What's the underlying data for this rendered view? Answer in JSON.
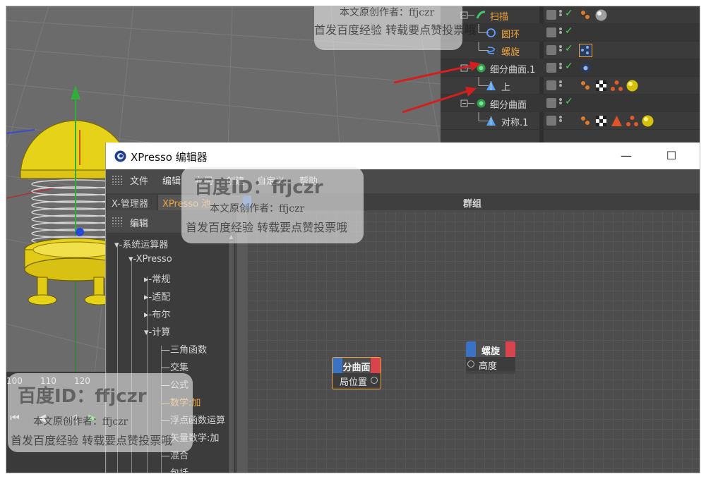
{
  "object_manager": {
    "rows": [
      {
        "name": "扫描",
        "color": "orange"
      },
      {
        "name": "圆环",
        "color": "orange"
      },
      {
        "name": "螺旋",
        "color": "orange"
      },
      {
        "name": "细分曲面.1",
        "color": "grey"
      },
      {
        "name": "上",
        "color": "grey"
      },
      {
        "name": "细分曲面",
        "color": "grey"
      },
      {
        "name": "对称.1",
        "color": "grey"
      }
    ]
  },
  "xpresso": {
    "title": "XPresso 编辑器",
    "minimize_label": "—",
    "maximize_label": "☐",
    "menu": [
      "文件",
      "编辑",
      "布局",
      "创建",
      "自定义",
      "帮助"
    ],
    "tabs": [
      "X-管理器",
      "XPresso 池"
    ],
    "group_title": "群组",
    "left_panel_label": "编辑",
    "tree": [
      "系统运算器",
      "XPresso",
      "常规",
      "适配",
      "布尔",
      "计算",
      "三角函数",
      "交集",
      "公式",
      "数学:加",
      "浮点函数运算",
      "矢量数学:加",
      "混合",
      "包括"
    ],
    "nodes": {
      "left": {
        "title": "分曲面",
        "port": "局位置"
      },
      "right": {
        "title": "螺旋",
        "port": "高度"
      }
    }
  },
  "timeline": {
    "ticks": [
      "100",
      "110",
      "120"
    ]
  },
  "watermarks": {
    "id_text": "百度ID：ffjczr",
    "author_text": "本文原创作者：ffjczr",
    "publish_text": "首发百度经验 转载要点赞投票哦"
  },
  "colors": {
    "accent_orange": "#f0a43a",
    "port_blue": "#3a72c4",
    "port_red": "#d8444e",
    "arrow_red": "#d21f1f"
  }
}
